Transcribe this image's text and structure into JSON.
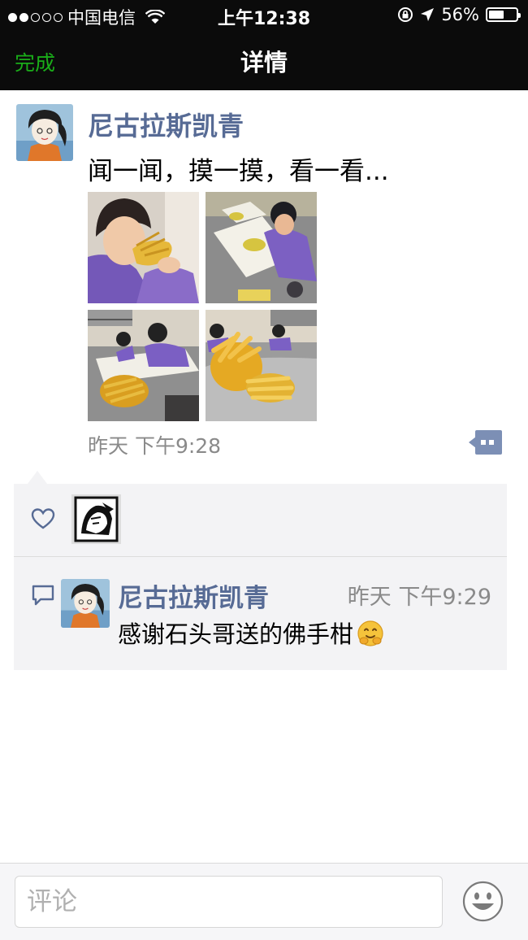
{
  "status_bar": {
    "carrier": "中国电信",
    "time": "上午12:38",
    "battery": "56%",
    "battery_level": 0.56,
    "signal_bars": 2
  },
  "nav": {
    "done_label": "完成",
    "title": "详情"
  },
  "post": {
    "author": "尼古拉斯凯青",
    "text": "闻一闻，摸一摸，看一看...",
    "time": "昨天 下午9:28",
    "photo_count": 4
  },
  "likes": {
    "icon": "heart-outline-icon",
    "users": [
      "liker-avatar"
    ]
  },
  "comments": [
    {
      "author": "尼古拉斯凯青",
      "time": "昨天 下午9:29",
      "text": "感谢石头哥送的佛手柑",
      "emoji": "hugging-face-emoji"
    }
  ],
  "composer": {
    "placeholder": "评论",
    "emoji_button_icon": "smiley-icon"
  },
  "colors": {
    "accent_green": "#1aad19",
    "link_blue": "#576b95",
    "panel_bg": "#f3f3f5",
    "bar_bg": "#0b0b0b"
  }
}
